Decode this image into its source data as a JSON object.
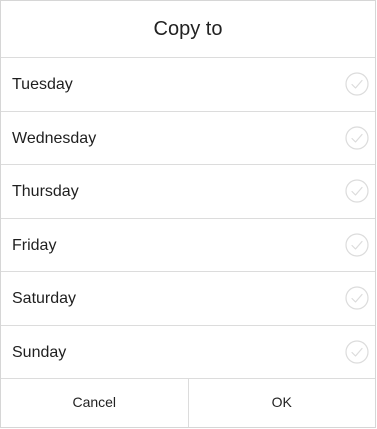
{
  "dialog": {
    "title": "Copy to",
    "days": [
      {
        "label": "Tuesday",
        "checked": false
      },
      {
        "label": "Wednesday",
        "checked": false
      },
      {
        "label": "Thursday",
        "checked": false
      },
      {
        "label": "Friday",
        "checked": false
      },
      {
        "label": "Saturday",
        "checked": false
      },
      {
        "label": "Sunday",
        "checked": false
      }
    ],
    "cancel_label": "Cancel",
    "ok_label": "OK",
    "check_icon": "check-circle-icon",
    "colors": {
      "check_outline": "#dcdcdc",
      "divider": "#dcdcdc",
      "text": "#222222"
    }
  }
}
